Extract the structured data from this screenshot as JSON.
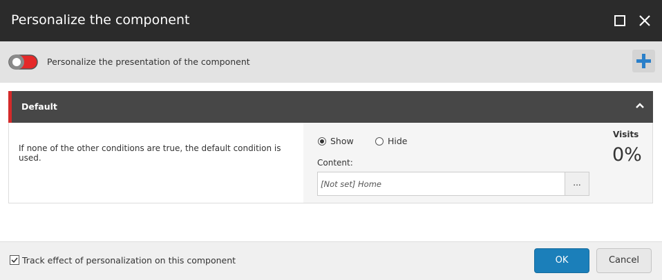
{
  "dialog": {
    "title": "Personalize the component"
  },
  "toolbar": {
    "personalize_label": "Personalize the presentation of the component",
    "toggle_on_color": "#e52929"
  },
  "section": {
    "title": "Default",
    "condition_text": "If none of the other conditions are true, the default condition is used.",
    "show_label": "Show",
    "hide_label": "Hide",
    "selected_action": "Show",
    "content_label": "Content:",
    "content_value": "[Not set] Home",
    "browse_label": "...",
    "visits_label": "Visits",
    "visits_value": "0%",
    "accent_color": "#d42a2a"
  },
  "footer": {
    "track_label": "Track effect of personalization on this component",
    "track_checked": true,
    "ok_label": "OK",
    "cancel_label": "Cancel"
  },
  "icons": {
    "maximize": "square-icon",
    "close": "close-icon",
    "add": "plus-icon",
    "collapse": "chevron-up-icon",
    "checkbox": "checkmark-icon"
  }
}
